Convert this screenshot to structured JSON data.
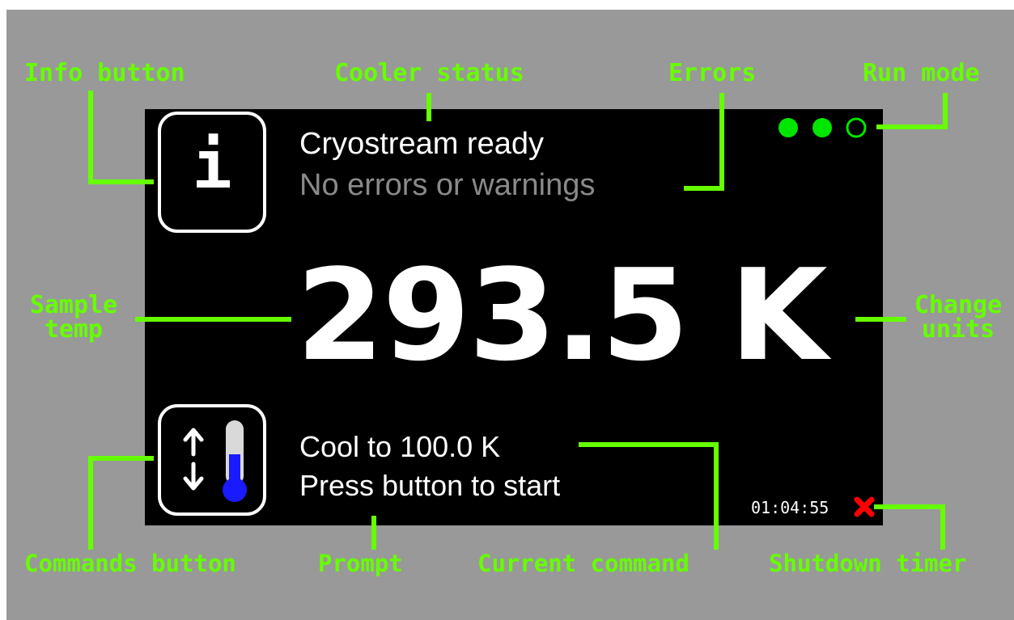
{
  "device": {
    "cooler_status": "Cryostream ready",
    "errors": "No errors or warnings",
    "sample_temp": "293.5 K",
    "current_command": "Cool to 100.0 K",
    "prompt": "Press button to start",
    "shutdown_timer": "01:04:55",
    "run_mode": [
      {
        "state": "on",
        "color": "#00e600"
      },
      {
        "state": "on",
        "color": "#00e600"
      },
      {
        "state": "off",
        "color": "#00e600"
      }
    ]
  },
  "icons": {
    "info": "info-icon",
    "commands": "up-down-thermometer-icon",
    "timer_cancel": "red-x-icon"
  },
  "annotations": {
    "info_button": "Info button",
    "cooler_status": "Cooler status",
    "errors": "Errors",
    "run_mode": "Run mode",
    "sample_temp_line1": "Sample",
    "sample_temp_line2": "temp",
    "change_units_line1": "Change",
    "change_units_line2": "units",
    "commands_button": "Commands button",
    "prompt": "Prompt",
    "current_command": "Current command",
    "shutdown_timer": "Shutdown timer"
  },
  "colors": {
    "annotation": "#66ff00",
    "background": "#999999",
    "screen": "#000000",
    "error_text": "#8a8a8a",
    "thermometer_fill": "#1a1aff",
    "timer_x": "#ff0000"
  }
}
